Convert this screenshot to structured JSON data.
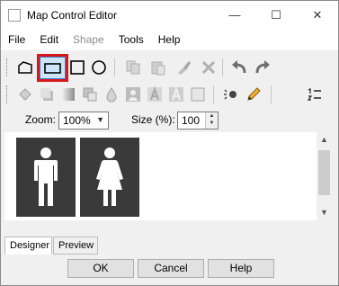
{
  "window": {
    "title": "Map Control Editor",
    "controls": {
      "minimize": "—",
      "maximize": "☐",
      "close": "✕"
    }
  },
  "menu": {
    "items": [
      {
        "label": "File",
        "enabled": true
      },
      {
        "label": "Edit",
        "enabled": true
      },
      {
        "label": "Shape",
        "enabled": false
      },
      {
        "label": "Tools",
        "enabled": true
      },
      {
        "label": "Help",
        "enabled": true
      }
    ]
  },
  "toolbar1": {
    "tools": [
      {
        "icon": "polygon-icon"
      },
      {
        "icon": "rectangle-icon",
        "selected": true
      },
      {
        "icon": "square-icon"
      },
      {
        "icon": "circle-icon"
      },
      {
        "icon": "copy-icon",
        "enabled": false
      },
      {
        "icon": "paste-icon",
        "enabled": false
      },
      {
        "icon": "format-brush-icon",
        "enabled": false
      },
      {
        "icon": "delete-icon",
        "enabled": false
      },
      {
        "icon": "undo-icon"
      },
      {
        "icon": "redo-icon"
      }
    ]
  },
  "toolbar2": {
    "tools": [
      {
        "icon": "fill-bucket-icon",
        "enabled": false
      },
      {
        "icon": "shadow-icon",
        "enabled": false
      },
      {
        "icon": "gradient-icon",
        "enabled": false
      },
      {
        "icon": "arrange-icon",
        "enabled": false
      },
      {
        "icon": "drop-icon",
        "enabled": false
      },
      {
        "icon": "image-icon",
        "enabled": false
      },
      {
        "icon": "text-icon",
        "enabled": false
      },
      {
        "icon": "text-outline-icon",
        "enabled": false
      },
      {
        "icon": "border-icon",
        "enabled": false
      },
      {
        "icon": "light-icon"
      },
      {
        "icon": "pencil-icon"
      },
      {
        "icon": "list-numbers-icon"
      }
    ]
  },
  "options": {
    "zoom_label": "Zoom:",
    "zoom_value": "100%",
    "size_label": "Size (%):",
    "size_value": "100"
  },
  "canvas": {
    "symbols": [
      {
        "icon": "male-figure-icon"
      },
      {
        "icon": "female-figure-icon"
      }
    ]
  },
  "tabs": [
    {
      "label": "Designer",
      "active": true
    },
    {
      "label": "Preview",
      "active": false
    }
  ],
  "buttons": {
    "ok": "OK",
    "cancel": "Cancel",
    "help": "Help"
  }
}
